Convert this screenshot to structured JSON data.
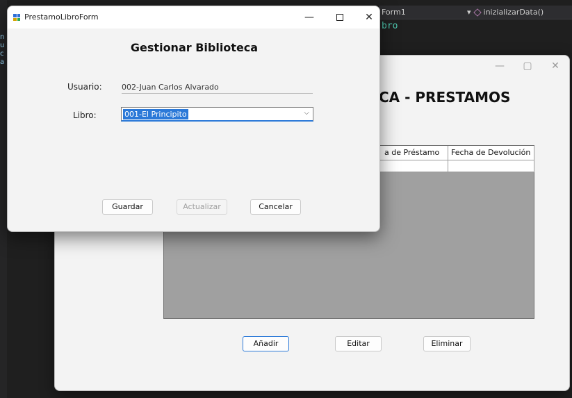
{
  "ide": {
    "tab_form": "Form1",
    "member_combo": "inizializarData()",
    "code_fragment": "bro",
    "left_fragment": "n u c a"
  },
  "form1": {
    "title": "CA - PRESTAMOS",
    "grid": {
      "columns": [
        "a de Préstamo",
        "Fecha de Devolución"
      ]
    },
    "buttons": {
      "add": "Añadir",
      "edit": "Editar",
      "delete": "Eliminar"
    },
    "caption": {
      "minimize": "—",
      "maximize": "▢",
      "close": "✕"
    }
  },
  "dialog": {
    "window_title": "PrestamoLibroForm",
    "heading": "Gestionar Biblioteca",
    "user_label": "Usuario:",
    "user_value": "002-Juan Carlos Alvarado",
    "book_label": "Libro:",
    "book_value": "001-El Principito",
    "buttons": {
      "save": "Guardar",
      "update": "Actualizar",
      "cancel": "Cancelar"
    },
    "caption": {
      "minimize": "—",
      "close": "✕"
    }
  },
  "colors": {
    "accent": "#2b79d8",
    "grid_background": "#a0a0a0"
  }
}
